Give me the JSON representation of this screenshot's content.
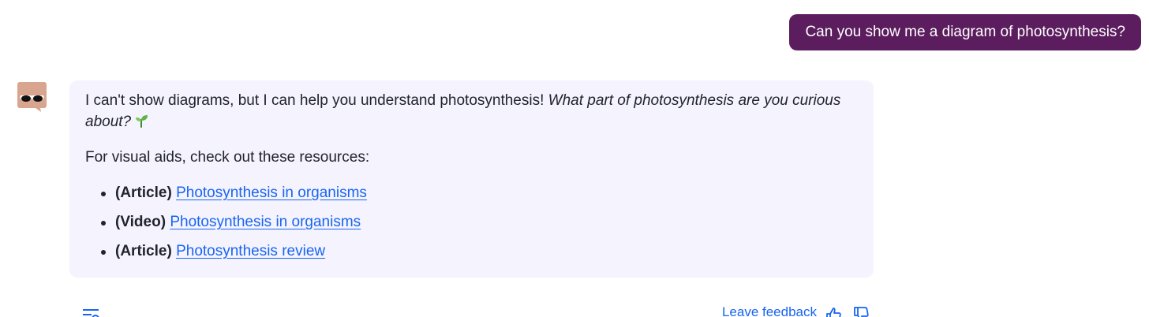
{
  "user_message": {
    "text": "Can you show me a diagram of photosynthesis?"
  },
  "assistant": {
    "avatar_icon": "khanmigo-eyes-icon",
    "reply_plain": "I can't show diagrams, but I can help you understand photosynthesis! ",
    "reply_italic": "What part of photosynthesis are you curious about?",
    "reply_emoji_icon": "seedling-icon",
    "resources_heading": "For visual aids, check out these resources:",
    "resources": [
      {
        "kind": "(Article)",
        "title": "Photosynthesis in organisms"
      },
      {
        "kind": "(Video)",
        "title": "Photosynthesis in organisms"
      },
      {
        "kind": "(Article)",
        "title": "Photosynthesis review"
      }
    ]
  },
  "footer": {
    "menu_icon": "list-icon",
    "feedback_label": "Leave feedback",
    "thumbs_up_icon": "thumbs-up-icon",
    "thumbs_down_icon": "thumbs-down-icon"
  },
  "colors": {
    "user_bubble": "#5b1d5e",
    "assistant_bubble": "#f5f3fd",
    "link": "#1865f2",
    "avatar": "#d9a58f"
  }
}
